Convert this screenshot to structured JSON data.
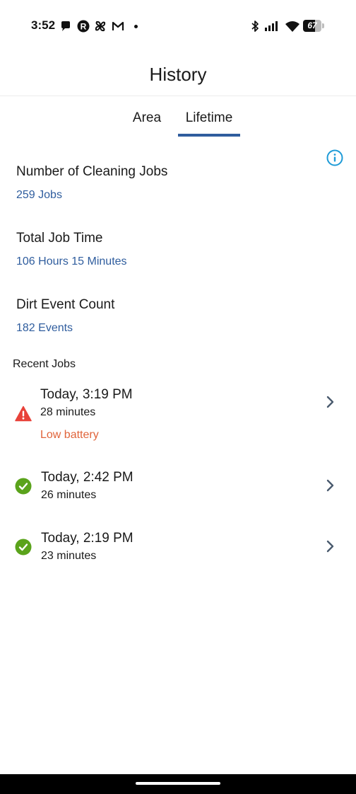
{
  "status_bar": {
    "time": "3:52",
    "battery_level": "67",
    "battery_fraction": 0.67
  },
  "header": {
    "title": "History"
  },
  "tabs": [
    {
      "label": "Area",
      "selected": false
    },
    {
      "label": "Lifetime",
      "selected": true
    }
  ],
  "stats": [
    {
      "label": "Number of Cleaning Jobs",
      "value": "259 Jobs"
    },
    {
      "label": "Total Job Time",
      "value": "106 Hours 15 Minutes"
    },
    {
      "label": "Dirt Event Count",
      "value": "182 Events"
    }
  ],
  "recent_jobs": {
    "title": "Recent Jobs",
    "items": [
      {
        "title": "Today, 3:19 PM",
        "duration": "28 minutes",
        "status": "warning",
        "status_text": "Low battery"
      },
      {
        "title": "Today, 2:42 PM",
        "duration": "26 minutes",
        "status": "success"
      },
      {
        "title": "Today, 2:19 PM",
        "duration": "23 minutes",
        "status": "success"
      }
    ]
  },
  "colors": {
    "accent": "#2f5d9e",
    "info": "#1e9bd7",
    "success": "#5aa31b",
    "warning": "#e8423a",
    "warning_text": "#e0643a"
  },
  "icons": {
    "info": "info-circle-icon",
    "warning": "warning-triangle-icon",
    "success": "check-circle-icon",
    "row_action": "chevron-right-icon"
  }
}
